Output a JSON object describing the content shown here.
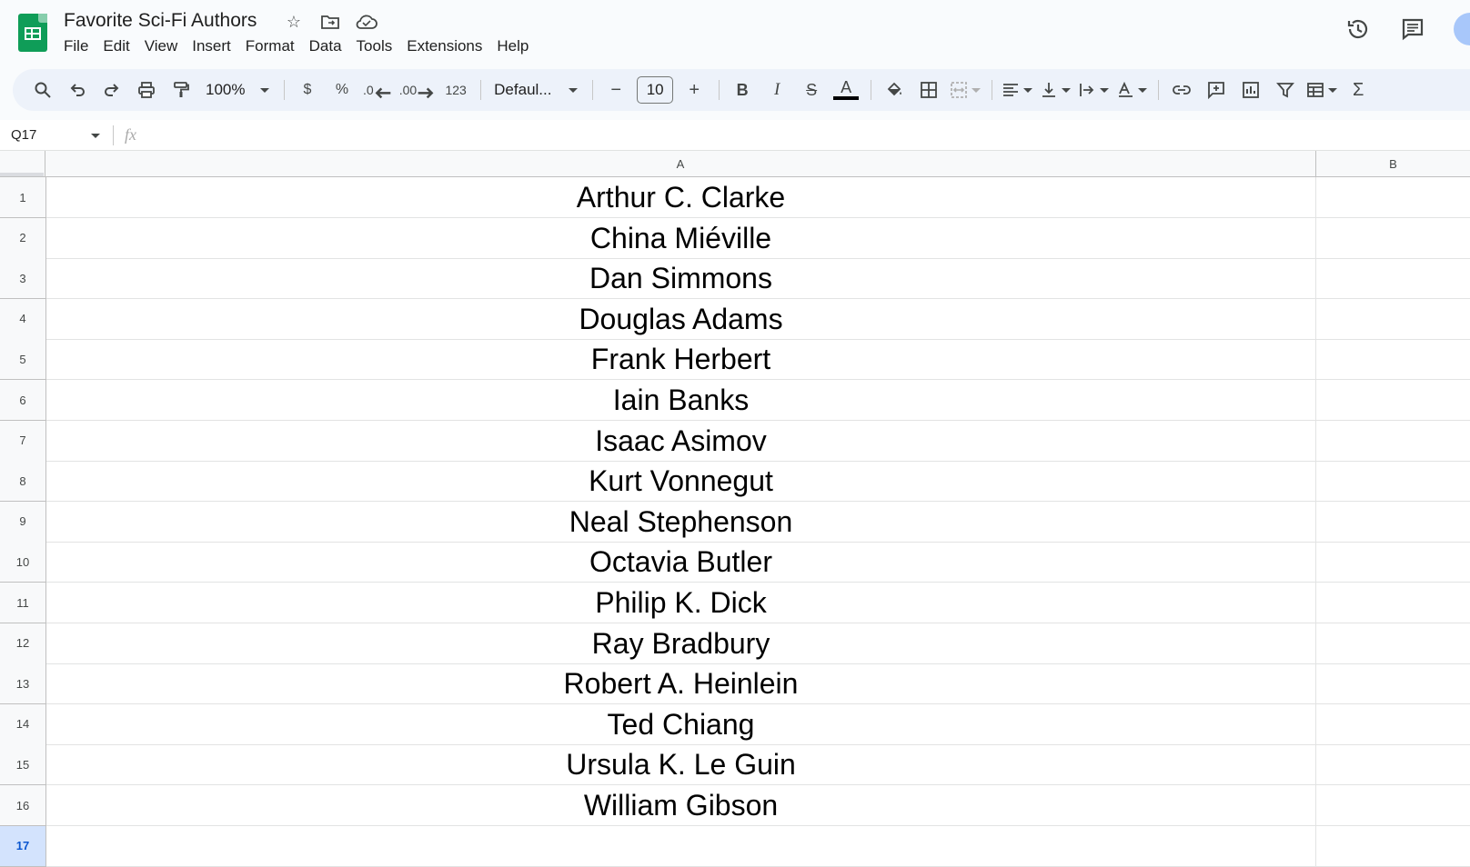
{
  "doc": {
    "title": "Favorite Sci-Fi Authors"
  },
  "menu": [
    "File",
    "Edit",
    "View",
    "Insert",
    "Format",
    "Data",
    "Tools",
    "Extensions",
    "Help"
  ],
  "toolbar": {
    "zoom": "100%",
    "currency": "$",
    "percent": "%",
    "dec_decrease": ".0",
    "dec_increase": ".00",
    "number_format": "123",
    "font": "Defaul...",
    "font_size": "10",
    "minus": "−",
    "plus": "+",
    "bold": "B",
    "italic": "I",
    "strike": "S",
    "text_color_letter": "A",
    "sigma": "Σ"
  },
  "formula_bar": {
    "name_box": "Q17",
    "fx": "fx"
  },
  "columns": [
    "A",
    "B"
  ],
  "rows": [
    {
      "num": "1",
      "a": "Arthur C. Clarke"
    },
    {
      "num": "2",
      "a": "China Miéville"
    },
    {
      "num": "3",
      "a": "Dan Simmons"
    },
    {
      "num": "4",
      "a": "Douglas Adams"
    },
    {
      "num": "5",
      "a": "Frank Herbert"
    },
    {
      "num": "6",
      "a": "Iain Banks"
    },
    {
      "num": "7",
      "a": "Isaac Asimov"
    },
    {
      "num": "8",
      "a": "Kurt Vonnegut"
    },
    {
      "num": "9",
      "a": "Neal Stephenson"
    },
    {
      "num": "10",
      "a": "Octavia Butler"
    },
    {
      "num": "11",
      "a": "Philip K. Dick"
    },
    {
      "num": "12",
      "a": "Ray Bradbury"
    },
    {
      "num": "13",
      "a": "Robert A. Heinlein"
    },
    {
      "num": "14",
      "a": "Ted Chiang"
    },
    {
      "num": "15",
      "a": "Ursula K. Le Guin"
    },
    {
      "num": "16",
      "a": "William Gibson"
    },
    {
      "num": "17",
      "a": ""
    }
  ],
  "colors": {
    "brand_green": "#0f9d58",
    "toolbar_bg": "#edf2fa",
    "selected_row": "#d3e3fd"
  }
}
